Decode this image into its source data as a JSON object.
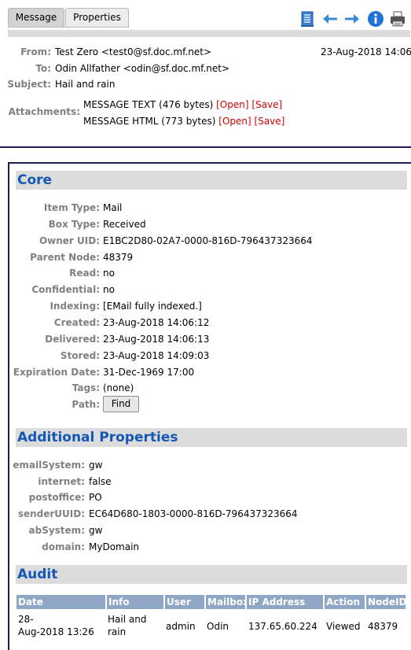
{
  "tabs": {
    "message": "Message",
    "properties": "Properties"
  },
  "header": {
    "from_label": "From:",
    "from_value": "Test Zero <test0@sf.doc.mf.net>",
    "date": "23-Aug-2018 14:06",
    "to_label": "To:",
    "to_value": "Odin Allfather <odin@sf.doc.mf.net>",
    "subject_label": "Subject:",
    "subject_value": "Hail and rain",
    "attachments_label": "Attachments:",
    "attachments": [
      {
        "name": "MESSAGE TEXT (476 bytes)",
        "open": "[Open]",
        "save": "[Save]"
      },
      {
        "name": "MESSAGE HTML (773 bytes)",
        "open": "[Open]",
        "save": "[Save]"
      }
    ]
  },
  "core": {
    "title": "Core",
    "rows": [
      {
        "label": "Item Type:",
        "value": "Mail"
      },
      {
        "label": "Box Type:",
        "value": "Received"
      },
      {
        "label": "Owner UID:",
        "value": "E1BC2D80-02A7-0000-816D-796437323664"
      },
      {
        "label": "Parent Node:",
        "value": "48379"
      },
      {
        "label": "Read:",
        "value": "no"
      },
      {
        "label": "Confidential:",
        "value": "no"
      },
      {
        "label": "Indexing:",
        "value": "[EMail fully indexed.]"
      },
      {
        "label": "Created:",
        "value": "23-Aug-2018 14:06:12"
      },
      {
        "label": "Delivered:",
        "value": "23-Aug-2018 14:06:13"
      },
      {
        "label": "Stored:",
        "value": "23-Aug-2018 14:09:03"
      },
      {
        "label": "Expiration Date:",
        "value": "31-Dec-1969 17:00"
      },
      {
        "label": "Tags:",
        "value": "(none)"
      },
      {
        "label": "Path:",
        "value": ""
      }
    ],
    "find_button": "Find"
  },
  "additional": {
    "title": "Additional Properties",
    "rows": [
      {
        "label": "emailSystem:",
        "value": "gw"
      },
      {
        "label": "internet:",
        "value": "false"
      },
      {
        "label": "postoffice:",
        "value": "PO"
      },
      {
        "label": "senderUUID:",
        "value": "EC64D680-1803-0000-816D-796437323664"
      },
      {
        "label": "abSystem:",
        "value": "gw"
      },
      {
        "label": "domain:",
        "value": "MyDomain"
      }
    ]
  },
  "audit": {
    "title": "Audit",
    "columns": [
      "Date",
      "Info",
      "User",
      "Mailbox",
      "IP Address",
      "Action",
      "NodeID"
    ],
    "rows": [
      {
        "date_line1": "28-",
        "date_line2": "Aug-2018 13:26",
        "info_line1": "Hail and",
        "info_line2": "rain",
        "user": "admin",
        "mailbox": "Odin",
        "ip": "137.65.60.224",
        "action": "Viewed",
        "node": "48379"
      }
    ]
  },
  "colors": {
    "section_title": "#1457b4",
    "link_red": "#cc0000",
    "audit_header": "#8fa6c4"
  },
  "toolbar_icons": [
    "document-icon",
    "arrow-left-icon",
    "arrow-right-icon",
    "info-icon",
    "print-icon"
  ]
}
